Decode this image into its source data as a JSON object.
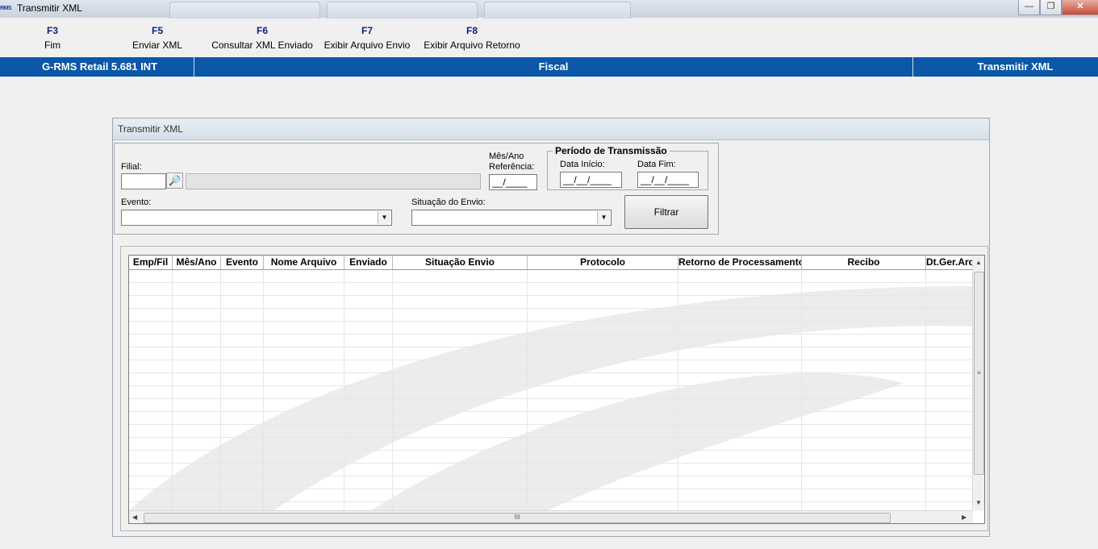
{
  "window": {
    "title": "Transmitir XML",
    "app_icon_text": "RMS",
    "minimize_glyph": "—",
    "restore_glyph": "❐",
    "close_glyph": "✕"
  },
  "toolbar": [
    {
      "key": "F3",
      "label": "Fim"
    },
    {
      "key": "F5",
      "label": "Enviar XML"
    },
    {
      "key": "F6",
      "label": "Consultar XML Enviado"
    },
    {
      "key": "F7",
      "label": "Exibir Arquivo Envio"
    },
    {
      "key": "F8",
      "label": "Exibir Arquivo Retorno"
    }
  ],
  "header_bar": {
    "product": "G-RMS Retail 5.681 INT",
    "module": "Fiscal",
    "screen": "Transmitir XML",
    "color": "#0b57a8"
  },
  "panel": {
    "title": "Transmitir XML"
  },
  "filters": {
    "filial_label": "Filial:",
    "filial_value": "",
    "filial_desc": "",
    "mes_ano_label_1": "Mês/Ano",
    "mes_ano_label_2": "Referência:",
    "mes_ano_value": "__/____",
    "periodo_legend": "Período de Transmissão",
    "data_inicio_label": "Data Início:",
    "data_inicio_value": "__/__/____",
    "data_fim_label": "Data Fim:",
    "data_fim_value": "__/__/____",
    "evento_label": "Evento:",
    "evento_value": "",
    "situacao_label": "Situação do Envio:",
    "situacao_value": "",
    "filtrar_label": "Filtrar",
    "binoculars_icon": "binoculars-icon"
  },
  "grid": {
    "columns": [
      "Emp/Fil",
      "Mês/Ano",
      "Evento",
      "Nome Arquivo",
      "Enviado",
      "Situação Envio",
      "Protocolo",
      "Retorno de Processamento",
      "Recibo",
      "Dt.Ger.Arq"
    ],
    "rows": [],
    "hscroll_grip": "III",
    "vscroll_grip": "≡"
  }
}
